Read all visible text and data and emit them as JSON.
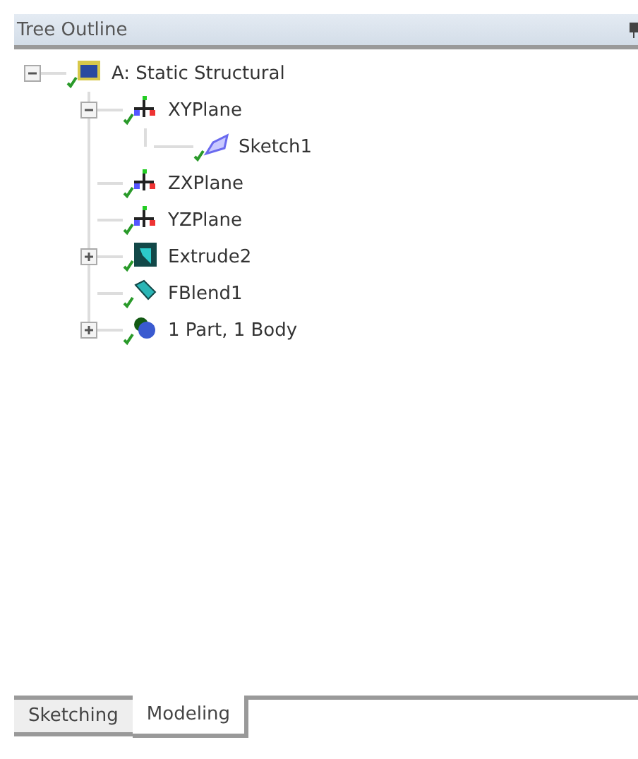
{
  "panel": {
    "title": "Tree Outline"
  },
  "tree": [
    {
      "label": "A: Static Structural",
      "kind": "model",
      "expanded": true,
      "children": [
        {
          "label": "XYPlane",
          "kind": "plane",
          "expanded": true,
          "children": [
            {
              "label": "Sketch1",
              "kind": "sketch"
            }
          ]
        },
        {
          "label": "ZXPlane",
          "kind": "plane"
        },
        {
          "label": "YZPlane",
          "kind": "plane"
        },
        {
          "label": "Extrude2",
          "kind": "extrude",
          "expanded": false
        },
        {
          "label": "FBlend1",
          "kind": "blend"
        },
        {
          "label": "1 Part, 1 Body",
          "kind": "body",
          "expanded": false
        }
      ]
    }
  ],
  "tabs": [
    {
      "label": "Sketching",
      "selected": false
    },
    {
      "label": "Modeling",
      "selected": true
    }
  ]
}
